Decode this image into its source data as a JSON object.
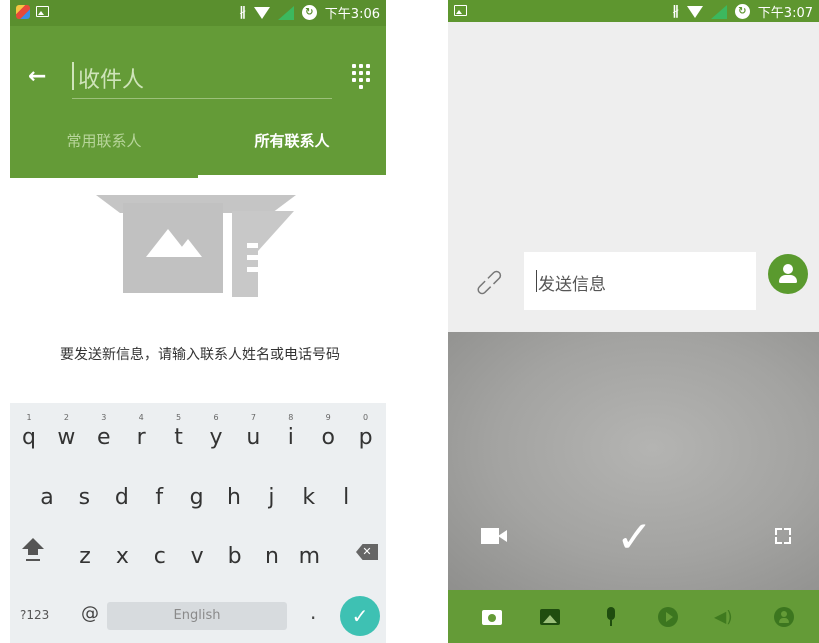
{
  "left_screen": {
    "status_bar": {
      "time": "下午3:06",
      "bluetooth_icon": "bluetooth-icon",
      "wifi_icon": "wifi-icon",
      "signal_icon": "signal-icon",
      "battery_icon": "battery-icon"
    },
    "header": {
      "recipient_placeholder": "收件人",
      "back_icon": "arrow-left-icon",
      "dialpad_icon": "dialpad-icon"
    },
    "tabs": [
      {
        "label": "常用联系人",
        "active": false
      },
      {
        "label": "所有联系人",
        "active": true
      }
    ],
    "empty_hint": "要发送新信息，请输入联系人姓名或电话号码",
    "keyboard": {
      "row1": [
        "q",
        "w",
        "e",
        "r",
        "t",
        "y",
        "u",
        "i",
        "o",
        "p"
      ],
      "row1_numbers": [
        "1",
        "2",
        "3",
        "4",
        "5",
        "6",
        "7",
        "8",
        "9",
        "0"
      ],
      "row2": [
        "a",
        "s",
        "d",
        "f",
        "g",
        "h",
        "j",
        "k",
        "l"
      ],
      "row3": [
        "z",
        "x",
        "c",
        "v",
        "b",
        "n",
        "m"
      ],
      "symbols_key": "?123",
      "at_key": "@",
      "space_label": "English",
      "period_key": ".",
      "enter_icon": "check-icon",
      "shift_icon": "shift-icon",
      "backspace_icon": "backspace-icon"
    }
  },
  "right_screen": {
    "status_bar": {
      "time": "下午3:07"
    },
    "composer": {
      "placeholder": "发送信息",
      "attach_icon": "paperclip-icon",
      "contact_icon": "person-icon"
    },
    "camera": {
      "video_icon": "video-camera-icon",
      "capture_icon": "checkmark-icon",
      "fullscreen_icon": "fullscreen-icon"
    },
    "media_bar": [
      "camera-icon",
      "image-icon",
      "mic-icon",
      "play-icon",
      "volume-icon",
      "person-icon"
    ]
  }
}
